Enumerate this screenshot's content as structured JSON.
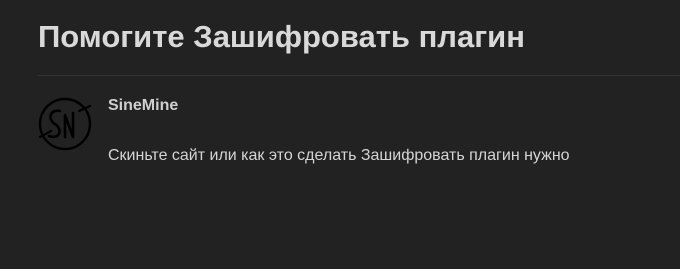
{
  "thread": {
    "title": "Помогите Зашифровать плагин"
  },
  "post": {
    "author": "SineMine",
    "avatar_icon": "sinemine-monogram-avatar",
    "body": "Скиньте сайт или как это сделать Зашифровать плагин нужно"
  }
}
